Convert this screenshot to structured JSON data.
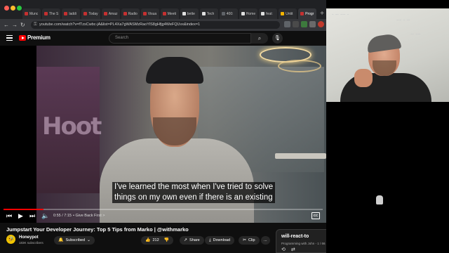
{
  "browser": {
    "tabs": [
      {
        "label": "Munc",
        "color": "#c53030"
      },
      {
        "label": "The S",
        "color": "#c53030"
      },
      {
        "label": "laddi",
        "color": "#c53030"
      },
      {
        "label": "Today",
        "color": "#c53030"
      },
      {
        "label": "Amaz",
        "color": "#c53030"
      },
      {
        "label": "Radio",
        "color": "#c53030"
      },
      {
        "label": "Visua",
        "color": "#c53030"
      },
      {
        "label": "Meeti",
        "color": "#c53030"
      },
      {
        "label": "bette",
        "color": "#e0e0e0"
      },
      {
        "label": "Tech",
        "color": "#e0e0e0"
      },
      {
        "label": "400:",
        "color": "#5f6368"
      },
      {
        "label": "Home",
        "color": "#e0e0e0"
      },
      {
        "label": "feat:",
        "color": "#e0e0e0"
      },
      {
        "label": "Untit",
        "color": "#f4b400"
      },
      {
        "label": "Progr",
        "color": "#c53030"
      }
    ],
    "url": "youtube.com/watch?v=fTzsCwbc-jA&list=PL4Xa7gWASMzRaoYlS8gHfjg4WeFQUvx&index=1"
  },
  "youtube": {
    "logo_text": "Premium",
    "search_placeholder": "Search",
    "subtitle_line1": "I've learned the most when I've tried to solve",
    "subtitle_line2": "things on my own even if there is an existing",
    "time": "0:55 / 7:15",
    "chapter": "• Give Back First  >",
    "progress": 0.126,
    "video_title": "Jumpstart Your Developer Journey: Top 5 Tips from Marko | @withmarko",
    "channel": "Honeypot",
    "subscribers": "183K subscribers",
    "subscribed_label": "Subscribed",
    "likes": "212",
    "share_label": "Share",
    "download_label": "Download",
    "clip_label": "Clip",
    "more_label": "...",
    "cc_label": "CC"
  },
  "playlist": {
    "title": "will-react-to",
    "subtitle": "Programming with John - 1 / 66"
  },
  "colors": {
    "accent": "#ff0000",
    "background": "#0f0f0f",
    "pill": "#272727"
  },
  "icons": [
    "search-icon",
    "mic-icon",
    "play-icon",
    "next-icon",
    "prev-icon",
    "volume-icon",
    "settings-icon",
    "miniplayer-icon",
    "theater-icon",
    "cast-icon",
    "fullscreen-icon",
    "bell-icon",
    "like-icon",
    "dislike-icon",
    "share-icon",
    "download-icon",
    "clip-icon",
    "close-icon",
    "loop-icon",
    "shuffle-icon"
  ]
}
